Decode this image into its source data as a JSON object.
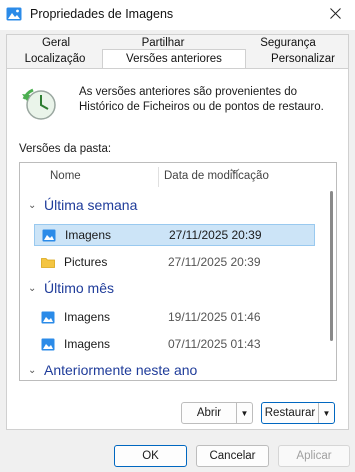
{
  "window": {
    "title": "Propriedades de Imagens",
    "close_icon": "close-icon"
  },
  "tabs": {
    "row1": [
      "Geral",
      "Partilhar",
      "Segurança"
    ],
    "row2": [
      "Localização",
      "Versões anteriores",
      "Personalizar"
    ],
    "active": "Versões anteriores"
  },
  "info": {
    "text": "As versões anteriores são provenientes do Histórico de Ficheiros ou de pontos de restauro."
  },
  "folder_versions_label": "Versões da pasta:",
  "list": {
    "headers": {
      "name": "Nome",
      "date": "Data de modificação"
    },
    "groups": [
      {
        "title": "Última semana",
        "items": [
          {
            "name": "Imagens",
            "date": "27/11/2025 20:39",
            "icon": "pictures-folder-icon",
            "selected": true
          },
          {
            "name": "Pictures",
            "date": "27/11/2025 20:39",
            "icon": "folder-icon",
            "selected": false
          }
        ]
      },
      {
        "title": "Último mês",
        "items": [
          {
            "name": "Imagens",
            "date": "19/11/2025 01:46",
            "icon": "pictures-folder-icon",
            "selected": false
          },
          {
            "name": "Imagens",
            "date": "07/11/2025 01:43",
            "icon": "pictures-folder-icon",
            "selected": false
          }
        ]
      },
      {
        "title": "Anteriormente neste ano",
        "items": []
      }
    ]
  },
  "buttons": {
    "open": "Abrir",
    "restore": "Restaurar",
    "ok": "OK",
    "cancel": "Cancelar",
    "apply": "Aplicar"
  },
  "colors": {
    "accent": "#0067c0",
    "group_title": "#1f3c9a",
    "selection": "#cce4f7"
  }
}
